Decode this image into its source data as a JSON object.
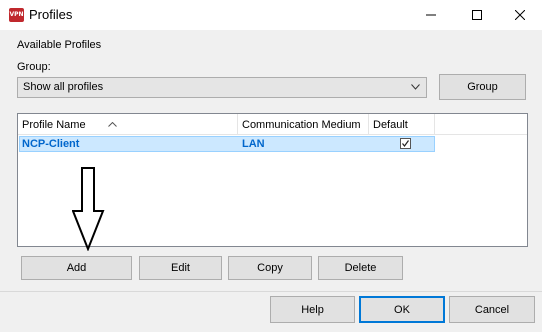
{
  "window": {
    "title": "Profiles",
    "icon_text": "VPN"
  },
  "profiles": {
    "section_label": "Available Profiles",
    "group_label": "Group:",
    "group_select_value": "Show all profiles",
    "group_button": "Group",
    "columns": [
      "Profile Name",
      "Communication Medium",
      "Default"
    ],
    "rows": [
      {
        "name": "NCP-Client",
        "medium": "LAN",
        "default": true
      }
    ],
    "buttons": {
      "add": "Add",
      "edit": "Edit",
      "copy": "Copy",
      "delete": "Delete"
    }
  },
  "footer": {
    "help": "Help",
    "ok": "OK",
    "cancel": "Cancel"
  },
  "colors": {
    "selection": "#cce8ff",
    "row_text": "#0066cc",
    "app_icon": "#c0282d",
    "default_button_border": "#0078d7"
  }
}
